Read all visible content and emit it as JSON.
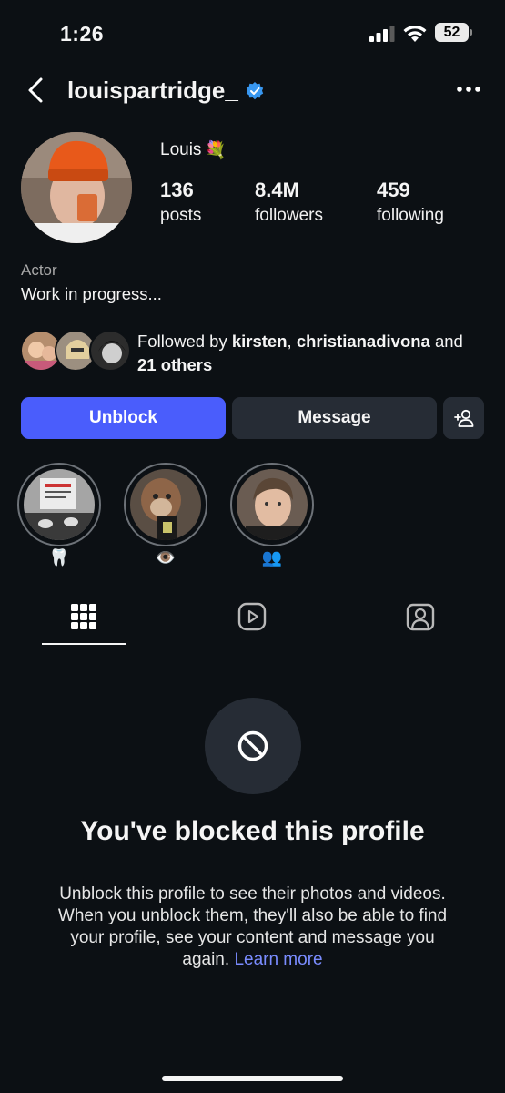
{
  "status_bar": {
    "time": "1:26",
    "battery": "52"
  },
  "header": {
    "username": "louispartridge_",
    "back_icon": "chevron-left-icon",
    "more_icon": "more-horizontal-icon"
  },
  "profile": {
    "display_name": "Louis",
    "name_emoji": "💐",
    "stats": [
      {
        "value": "136",
        "label": "posts"
      },
      {
        "value": "8.4M",
        "label": "followers"
      },
      {
        "value": "459",
        "label": "following"
      }
    ],
    "category": "Actor",
    "bio": "Work in progress..."
  },
  "followed_by": {
    "prefix": "Followed by ",
    "name1": "kirsten",
    "sep": ", ",
    "name2": "christianadivona",
    "mid": " and ",
    "others": "21 others"
  },
  "actions": {
    "unblock": "Unblock",
    "message": "Message"
  },
  "highlights": [
    {
      "label": "🦷"
    },
    {
      "label": "👁️"
    },
    {
      "label": "👥"
    }
  ],
  "tabs": [
    "grid-icon",
    "reels-icon",
    "tagged-icon"
  ],
  "blocked": {
    "title": "You've blocked this profile",
    "description": "Unblock this profile to see their photos and videos. When you unblock them, they'll also be able to find your profile, see your content and message you again.",
    "learn_more": "Learn more"
  },
  "colors": {
    "background": "#0c1014",
    "accent": "#4a5dfc",
    "link": "#7a8cff",
    "verified": "#3897f0"
  }
}
